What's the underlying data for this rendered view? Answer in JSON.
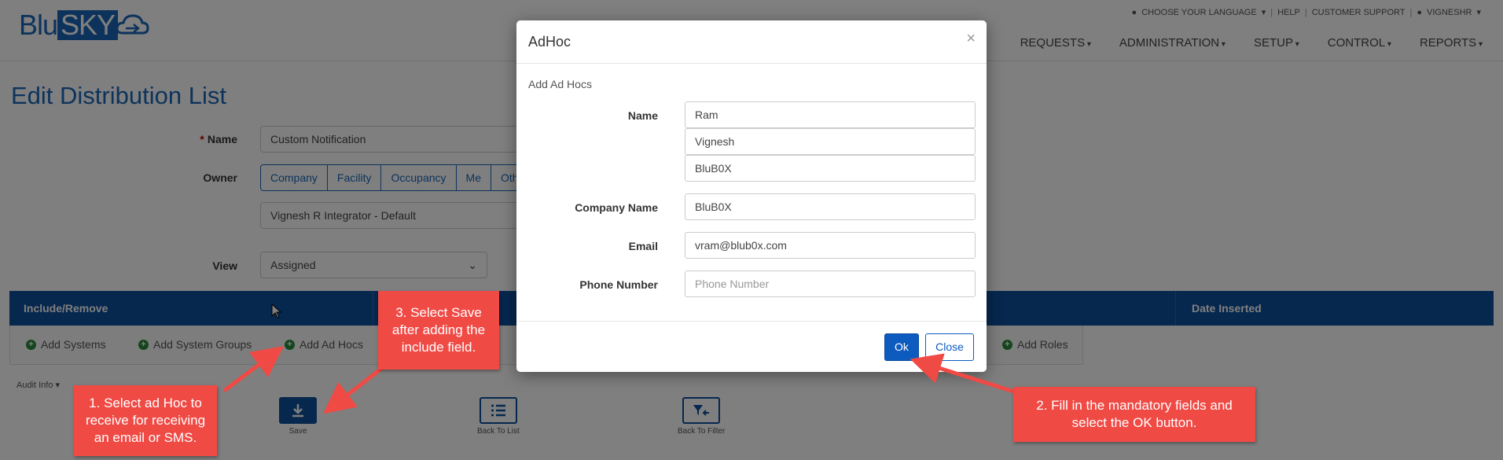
{
  "header": {
    "logo_blu": "Blu",
    "logo_sky": "SKY",
    "toplinks": [
      "CHOOSE YOUR LANGUAGE",
      "HELP",
      "CUSTOMER SUPPORT",
      "VIGNESHR"
    ],
    "nav": [
      "REQUESTS",
      "ADMINISTRATION",
      "SETUP",
      "CONTROL",
      "REPORTS"
    ]
  },
  "page": {
    "title": "Edit Distribution List",
    "name_label": "Name",
    "name_value": "Custom Notification",
    "owner_label": "Owner",
    "owner_options": [
      "Company",
      "Facility",
      "Occupancy",
      "Me",
      "Oth"
    ],
    "owner_value": "Vignesh R Integrator - Default",
    "view_label": "View",
    "view_value": "Assigned"
  },
  "table": {
    "headers": [
      "Include/Remove",
      "Date Inserted"
    ],
    "add_items": [
      "Add Systems",
      "Add System Groups",
      "Add Ad Hocs",
      "Add Roles"
    ]
  },
  "audit_label": "Audit Info",
  "actions": [
    "Save",
    "Back To List",
    "Back To Filter"
  ],
  "modal": {
    "title": "AdHoc",
    "close_glyph": "×",
    "section": "Add Ad Hocs",
    "name_label": "Name",
    "name_values": [
      "Ram",
      "Vignesh",
      "BluB0X"
    ],
    "company_label": "Company Name",
    "company_value": "BluB0X",
    "email_label": "Email",
    "email_value": "vram@blub0x.com",
    "phone_label": "Phone Number",
    "phone_placeholder": "Phone Number",
    "ok_label": "Ok",
    "close_label": "Close"
  },
  "callouts": {
    "step1": "1. Select ad Hoc to receive for receiving an email or SMS.",
    "step2": "2. Fill in the mandatory fields and select the OK button.",
    "step3": "3. Select Save after adding the include field."
  },
  "colors": {
    "brand": "#1a66b8",
    "table_header": "#0d4f9c",
    "callout": "#f04a45",
    "add_icon": "#2a8a3a"
  }
}
